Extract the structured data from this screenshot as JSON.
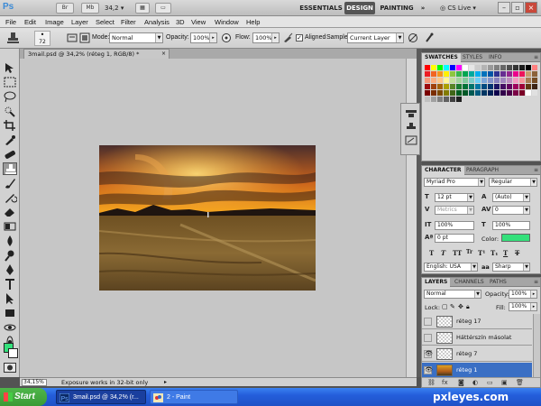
{
  "appbar": {
    "logo": "Ps",
    "zoom": "34,2",
    "workspaces": [
      "ESSENTIALS",
      "DESIGN",
      "PAINTING"
    ],
    "more": "»",
    "cslive": "CS Live"
  },
  "menu": [
    "File",
    "Edit",
    "Image",
    "Layer",
    "Select",
    "Filter",
    "Analysis",
    "3D",
    "View",
    "Window",
    "Help"
  ],
  "options": {
    "brush_size": "72",
    "mode_label": "Mode:",
    "mode_value": "Normal",
    "opacity_label": "Opacity:",
    "opacity_value": "100%",
    "flow_label": "Flow:",
    "flow_value": "100%",
    "aligned_label": "Aligned",
    "sample_label": "Sample:",
    "sample_value": "Current Layer"
  },
  "document": {
    "tab_title": "3mail.psd @ 34,2% (réteg 1, RGB/8) *",
    "close": "×"
  },
  "status": {
    "zoom": "34,15%",
    "text": "Exposure works in 32-bit only"
  },
  "colors": {
    "foreground": "#34e07b",
    "background": "#ffffff"
  },
  "swatches_panel": {
    "tabs": [
      "SWATCHES",
      "STYLES",
      "INFO"
    ]
  },
  "character": {
    "tabs": [
      "CHARACTER",
      "PARAGRAPH"
    ],
    "font_family": "Myriad Pro",
    "font_style": "Regular",
    "font_size": "12 pt",
    "leading": "(Auto)",
    "kerning": "Metrics",
    "tracking": "0",
    "vertical_scale": "100%",
    "horizontal_scale": "100%",
    "baseline_shift": "0 pt",
    "color_label": "Color:",
    "language": "English: USA",
    "antialias": "Sharp",
    "aa_icon": "aa"
  },
  "layers_panel": {
    "tabs": [
      "LAYERS",
      "CHANNELS",
      "PATHS"
    ],
    "blend_mode": "Normal",
    "opacity_label": "Opacity:",
    "opacity_value": "100%",
    "lock_label": "Lock:",
    "fill_label": "Fill:",
    "fill_value": "100%",
    "layers": [
      {
        "name": "réteg 17",
        "visible": false,
        "selected": false
      },
      {
        "name": "Háttérszín másolat",
        "visible": false,
        "selected": false
      },
      {
        "name": "réteg 7",
        "visible": true,
        "selected": false
      },
      {
        "name": "réteg 1",
        "visible": true,
        "selected": true
      }
    ]
  },
  "taskbar": {
    "start": "Start",
    "tasks": [
      "3mail.psd @ 34,2% (r...",
      "2 - Paint"
    ],
    "watermark": "pxleyes.com"
  }
}
